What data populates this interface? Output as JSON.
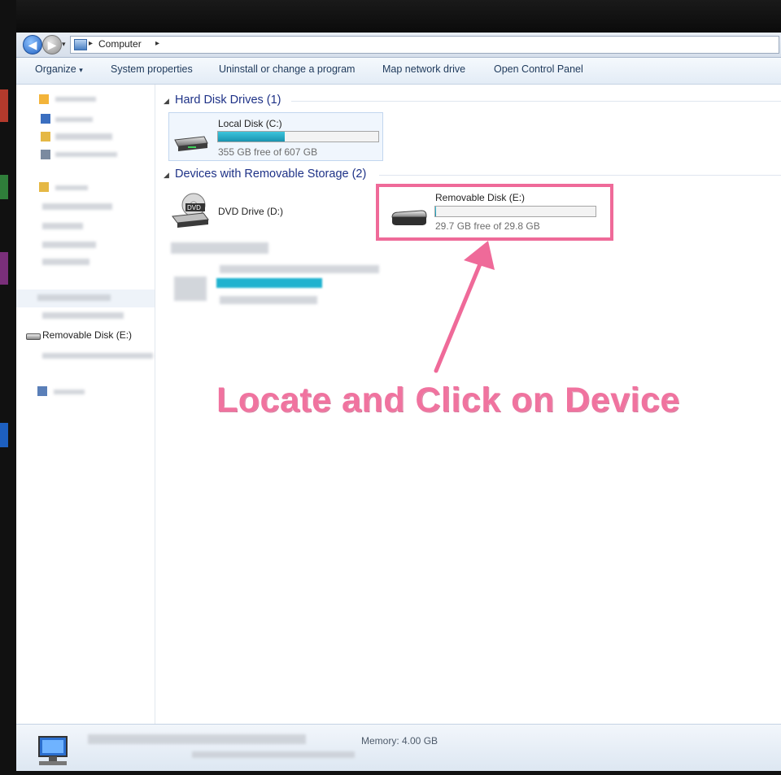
{
  "address_bar": {
    "breadcrumb": [
      "Computer"
    ],
    "separator": "▸"
  },
  "toolbar": {
    "organize_label": "Organize",
    "organize_arrow": "▾",
    "system_properties_label": "System properties",
    "uninstall_label": "Uninstall or change a program",
    "map_drive_label": "Map network drive",
    "control_panel_label": "Open Control Panel"
  },
  "nav_pane": {
    "removable_item_label": "Removable Disk (E:)"
  },
  "content": {
    "groups": [
      {
        "title": "Hard Disk Drives (1)",
        "items": [
          {
            "name": "Local Disk (C:)",
            "free_text": "355 GB free of 607 GB",
            "used_fraction": 0.415,
            "icon": "hard-drive-icon"
          }
        ]
      },
      {
        "title": "Devices with Removable Storage (2)",
        "items": [
          {
            "name": "DVD Drive (D:)",
            "icon": "dvd-drive-icon"
          },
          {
            "name": "Removable Disk (E:)",
            "free_text": "29.7 GB free of 29.8 GB",
            "used_fraction": 0.003,
            "icon": "removable-disk-icon"
          }
        ]
      }
    ]
  },
  "annotation": {
    "callout_text": "Locate and Click on Device",
    "highlight_color": "#ef6a99"
  },
  "status_bar": {
    "memory_text": "Memory: 4.00 GB"
  },
  "colors": {
    "group_header": "#1e3287",
    "bar_fill": "#2bb3cc",
    "toolbar_text": "#1e395b"
  }
}
